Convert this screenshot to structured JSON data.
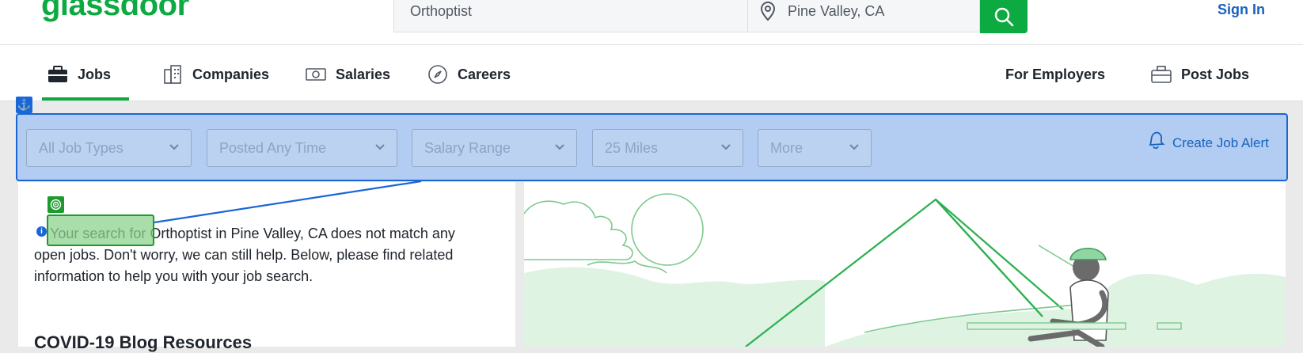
{
  "header": {
    "logo": "glassdoor",
    "search_value": "Orthoptist",
    "location_value": "Pine Valley, CA",
    "signin_label": "Sign In"
  },
  "nav": {
    "items": [
      {
        "label": "Jobs",
        "icon": "briefcase-icon"
      },
      {
        "label": "Companies",
        "icon": "building-icon"
      },
      {
        "label": "Salaries",
        "icon": "money-icon"
      },
      {
        "label": "Careers",
        "icon": "compass-icon"
      }
    ],
    "right_items": [
      {
        "label": "For Employers"
      },
      {
        "label": "Post Jobs",
        "icon": "post-jobs-icon"
      }
    ],
    "active": "Jobs"
  },
  "filters": {
    "dropdowns": [
      {
        "label": "All Job Types"
      },
      {
        "label": "Posted Any Time"
      },
      {
        "label": "Salary Range"
      },
      {
        "label": "25 Miles"
      },
      {
        "label": "More"
      }
    ],
    "create_alert_label": "Create Job Alert"
  },
  "content": {
    "highlight_text": "Your search for",
    "message": "Your search for Orthoptist in Pine Valley, CA does not match any open jobs. Don't worry, we can still help. Below, please find related information to help you with your job search.",
    "section_title": "COVID-19 Blog Resources"
  },
  "colors": {
    "brand": "#0caa41",
    "link": "#1861bf",
    "overlay_blue": "#1a66d6",
    "overlay_green": "#1d9a2e"
  }
}
